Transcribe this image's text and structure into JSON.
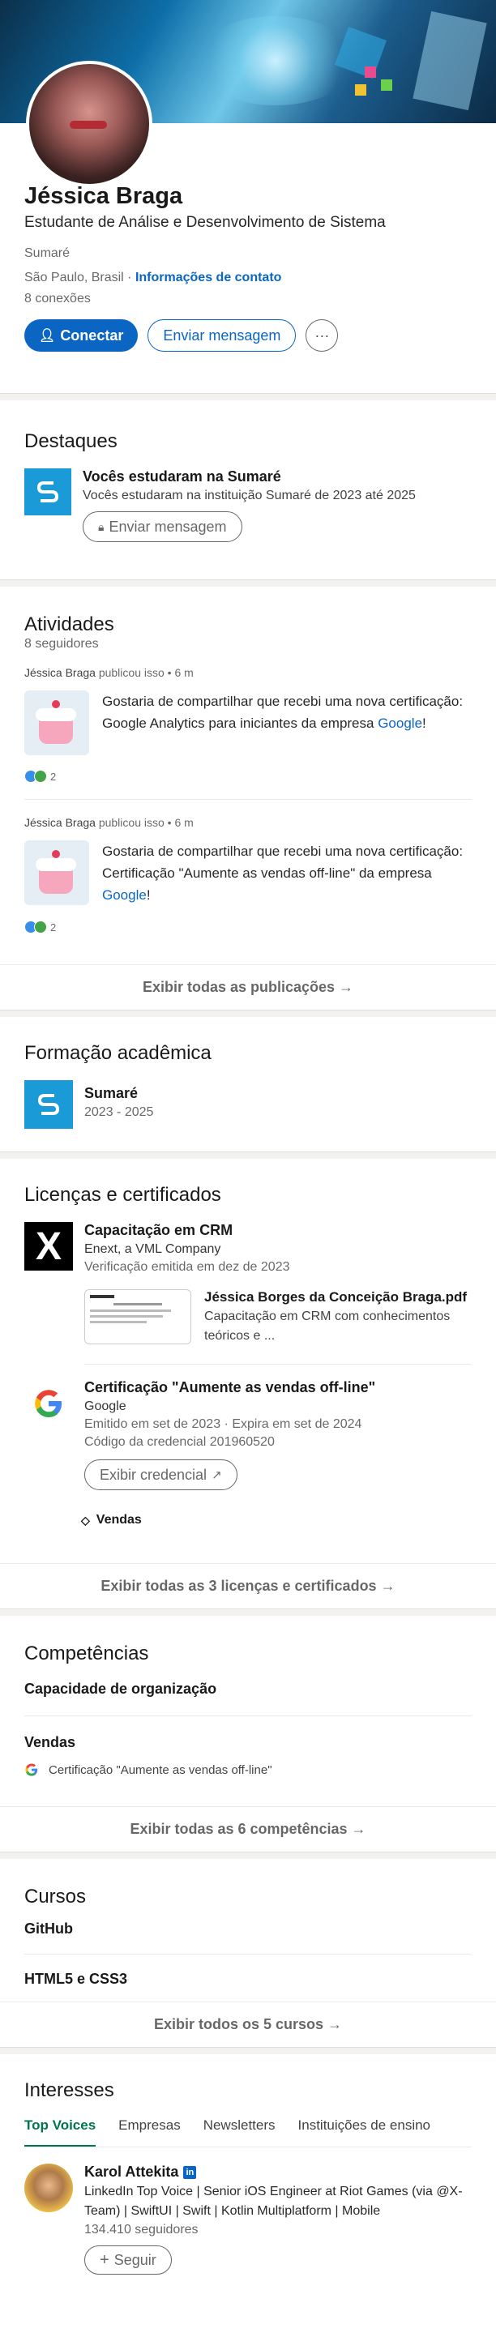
{
  "profile": {
    "name": "Jéssica Braga",
    "headline": "Estudante de Análise e Desenvolvimento de Sistema",
    "school": "Sumaré",
    "location": "São Paulo, Brasil",
    "location_sep": " · ",
    "contact_link": "Informações de contato",
    "connections": "8 conexões",
    "connect_label": "Conectar",
    "message_label": "Enviar mensagem",
    "more_label": "···"
  },
  "highlights": {
    "title": "Destaques",
    "item_title": "Vocês estudaram na Sumaré",
    "item_desc": "Vocês estudaram na instituição Sumaré de 2023 até 2025",
    "button": "Enviar mensagem"
  },
  "activity": {
    "title": "Atividades",
    "followers": "8 seguidores",
    "posts": [
      {
        "author": "Jéssica Braga",
        "action": " publicou isso • 6 m",
        "text": "Gostaria de compartilhar que recebi uma nova certificação: Google Analytics para iniciantes da empresa ",
        "link": "Google",
        "after": "!",
        "count": "2"
      },
      {
        "author": "Jéssica Braga",
        "action": " publicou isso • 6 m",
        "text": "Gostaria de compartilhar que recebi uma nova certificação: Certificação \"Aumente as vendas off-line\" da empresa ",
        "link": "Google",
        "after": "!",
        "count": "2"
      }
    ],
    "footer": "Exibir todas as publicações →"
  },
  "education": {
    "title": "Formação acadêmica",
    "school": "Sumaré",
    "years": "2023 - 2025"
  },
  "licenses": {
    "title": "Licenças e certificados",
    "items": [
      {
        "name": "Capacitação em CRM",
        "issuer": "Enext, a VML Company",
        "date": "Verificação emitida em dez de 2023",
        "doc_title": "Jéssica Borges da Conceição Braga.pdf",
        "doc_desc": "Capacitação em CRM com conhecimentos teóricos e ..."
      },
      {
        "name": "Certificação \"Aumente as vendas off-line\"",
        "issuer": "Google",
        "date": "Emitido em set de 2023 · Expira em set de 2024",
        "credential": "Código da credencial 201960520",
        "button": "Exibir credencial",
        "skill": "Vendas"
      }
    ],
    "footer": "Exibir todas as 3 licenças e certificados →"
  },
  "skills": {
    "title": "Competências",
    "items": [
      {
        "name": "Capacidade de organização"
      },
      {
        "name": "Vendas",
        "source": "Certificação \"Aumente as vendas off-line\""
      }
    ],
    "footer": "Exibir todas as 6 competências →"
  },
  "courses": {
    "title": "Cursos",
    "items": [
      "GitHub",
      "HTML5 e CSS3"
    ],
    "footer": "Exibir todos os 5 cursos →"
  },
  "interests": {
    "title": "Interesses",
    "tabs": [
      "Top Voices",
      "Empresas",
      "Newsletters",
      "Instituições de ensino"
    ],
    "person": {
      "name": "Karol Attekita",
      "bio": "LinkedIn Top Voice | Senior iOS Engineer at Riot Games (via @X-Team) | SwiftUI | Swift | Kotlin Multiplatform | Mobile",
      "followers": "134.410 seguidores",
      "button": "Seguir"
    }
  },
  "colors": {
    "brand": "#0a66c2",
    "sumare": "#1a9ad6"
  }
}
